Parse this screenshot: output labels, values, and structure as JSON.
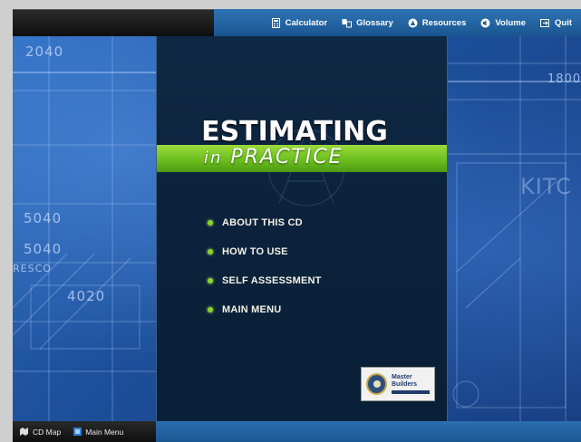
{
  "toolbar": {
    "items": [
      {
        "label": "Calculator",
        "icon": "calculator-icon"
      },
      {
        "label": "Glossary",
        "icon": "glossary-icon"
      },
      {
        "label": "Resources",
        "icon": "resources-icon"
      },
      {
        "label": "Volume",
        "icon": "volume-icon"
      },
      {
        "label": "Quit",
        "icon": "quit-icon"
      }
    ]
  },
  "background": {
    "labels": [
      "2040",
      "5040",
      "5040",
      "RESCO",
      "4020",
      "1800",
      "KITC"
    ]
  },
  "hero": {
    "title": "ESTIMATING",
    "subtitle_prefix": "in",
    "subtitle_main": "PRACTICE"
  },
  "nav": {
    "items": [
      {
        "label": "ABOUT THIS CD"
      },
      {
        "label": "HOW TO USE"
      },
      {
        "label": "SELF ASSESSMENT"
      },
      {
        "label": "MAIN MENU"
      }
    ]
  },
  "logo": {
    "line1": "Master",
    "line2": "Builders"
  },
  "footer": {
    "cd_map": "CD Map",
    "main_menu": "Main Menu"
  },
  "colors": {
    "accent_green": "#6cbf1f",
    "toolbar_blue": "#2466a6",
    "panel_navy": "#0c233d"
  }
}
